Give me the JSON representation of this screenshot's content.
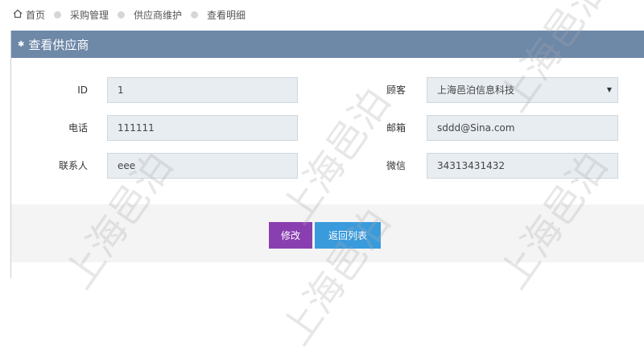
{
  "breadcrumb": {
    "items": [
      "首页",
      "采购管理",
      "供应商维护",
      "查看明细"
    ]
  },
  "panel": {
    "title": "查看供应商"
  },
  "form": {
    "id": {
      "label": "ID",
      "value": "1"
    },
    "customer": {
      "label": "顾客",
      "value": "上海邑泊信息科技"
    },
    "phone": {
      "label": "电话",
      "value": "111111"
    },
    "email": {
      "label": "邮箱",
      "value": "sddd@Sina.com"
    },
    "contact": {
      "label": "联系人",
      "value": "eee"
    },
    "wechat": {
      "label": "微信",
      "value": "34313431432"
    }
  },
  "actions": {
    "edit_label": "修改",
    "back_label": "返回列表"
  },
  "watermark": "上海邑泊",
  "colors": {
    "header": "#6e88a8",
    "edit_button": "#8a3fb0",
    "back_button": "#3a9bdc"
  }
}
